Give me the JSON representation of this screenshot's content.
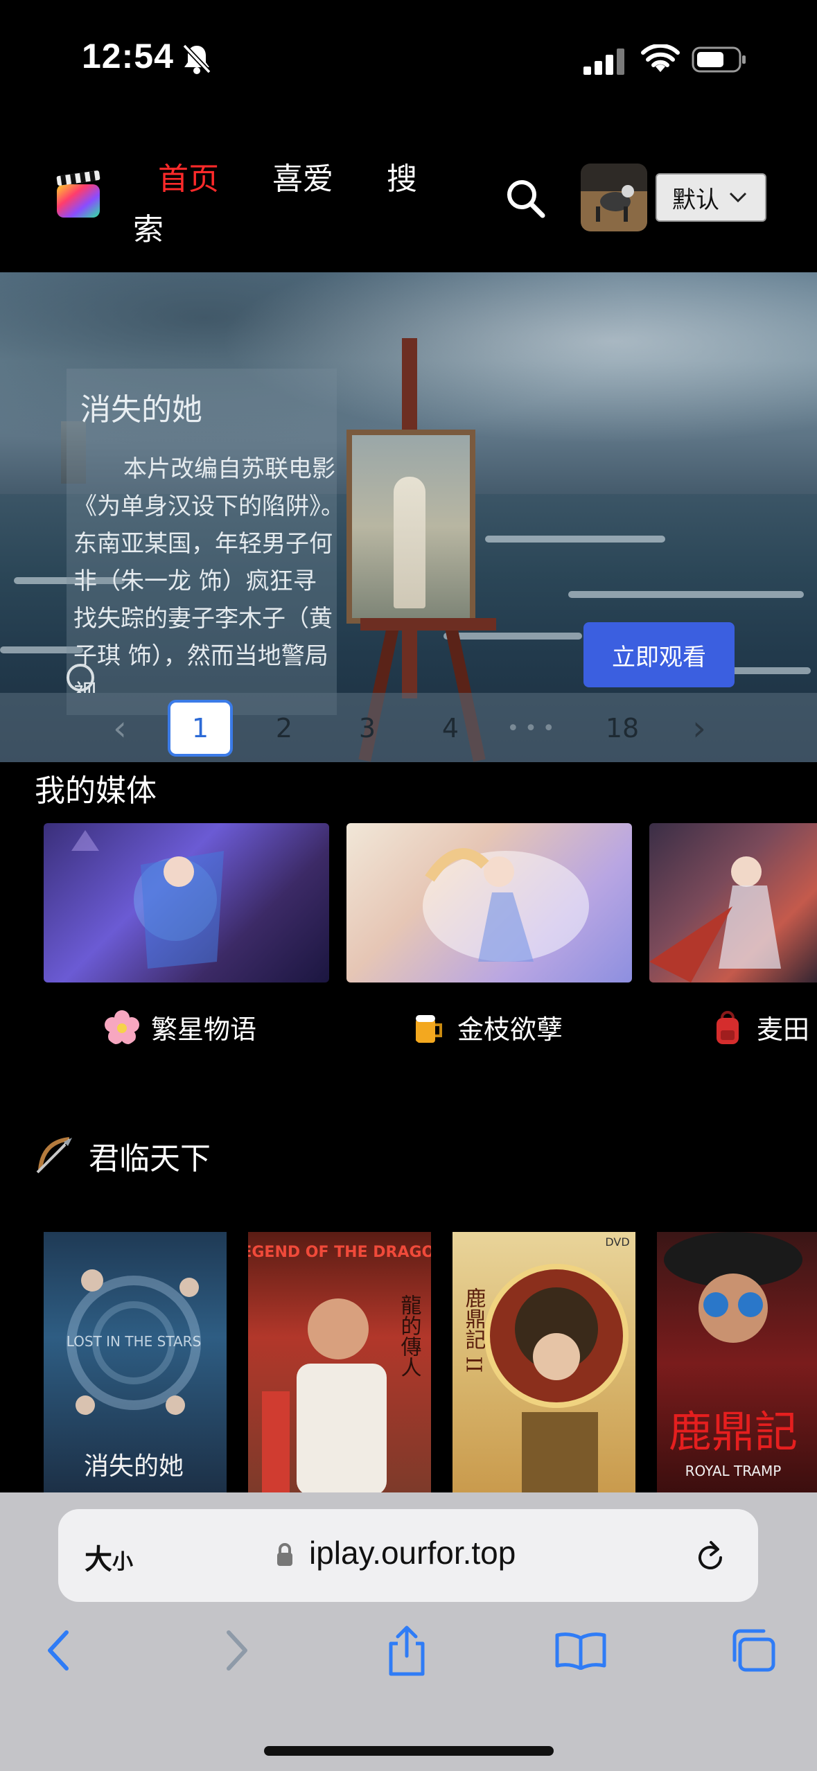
{
  "status_bar": {
    "time": "12:54"
  },
  "header": {
    "nav": {
      "home": "首页",
      "favorites": "喜爱",
      "search_part1": "搜",
      "search_part2": "索"
    },
    "select_value": "默认"
  },
  "hero": {
    "title": "消失的她",
    "description": "本片改编自苏联电影《为单身汉设下的陷阱》。　　东南亚某国，年轻男子何非（朱一龙 饰）疯狂寻找失踪的妻子李木子（黄子琪 饰），然而当地警局视",
    "watch_button": "立即观看"
  },
  "pagination": {
    "prev": "‹",
    "pages": [
      "1",
      "2",
      "3",
      "4"
    ],
    "ellipsis": "•••",
    "last": "18",
    "next": "›",
    "current": "1"
  },
  "my_media": {
    "title": "我的媒体",
    "items": [
      {
        "label": "繁星物语",
        "emoji": "flower-emoji"
      },
      {
        "label": "金枝欲孽",
        "emoji": "beer-emoji"
      },
      {
        "label": "麦田",
        "emoji": "backpack-emoji"
      }
    ]
  },
  "section2": {
    "title": "君临天下",
    "icon": "bow-and-arrow-emoji",
    "posters": [
      {
        "title": "消失的她",
        "overlay": "LOST IN THE STARS"
      },
      {
        "title": "LEGEND OF THE DRAGON",
        "overlay": "龍的傳人"
      },
      {
        "title": "鹿鼎記 II",
        "overlay": "DVD"
      },
      {
        "title": "鹿鼎記",
        "overlay": "ROYAL TRAMP"
      }
    ]
  },
  "browser": {
    "size_label_big": "大",
    "size_label_small": "小",
    "url": "iplay.ourfor.top"
  },
  "colors": {
    "accent_red": "#ff2a2a",
    "button_blue": "#3b5fe0",
    "pager_active_border": "#3b7be8",
    "ios_blue": "#2f7cf6"
  }
}
